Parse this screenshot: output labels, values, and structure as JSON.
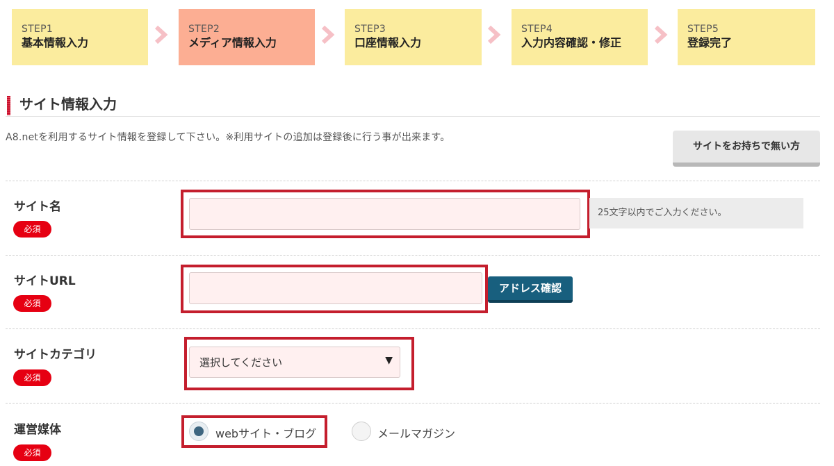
{
  "steps": [
    {
      "num": "STEP1",
      "title": "基本情報入力"
    },
    {
      "num": "STEP2",
      "title": "メディア情報入力"
    },
    {
      "num": "STEP3",
      "title": "口座情報入力"
    },
    {
      "num": "STEP4",
      "title": "入力内容確認・修正"
    },
    {
      "num": "STEP5",
      "title": "登録完了"
    }
  ],
  "section": {
    "title": "サイト情報入力",
    "description": "A8.netを利用するサイト情報を登録して下さい。※利用サイトの追加は登録後に行う事が出来ます。",
    "no_site_button": "サイトをお持ちで無い方"
  },
  "required_badge": "必須",
  "fields": {
    "site_name": {
      "label": "サイト名",
      "value": "",
      "hint": "25文字以内でご入力ください。"
    },
    "site_url": {
      "label": "サイトURL",
      "value": "",
      "check_button": "アドレス確認"
    },
    "site_category": {
      "label": "サイトカテゴリ",
      "selected": "選択してください",
      "arrow_icon": "triangle-down"
    },
    "media_type": {
      "label": "運営媒体",
      "options": [
        "webサイト・ブログ",
        "メールマガジン"
      ],
      "selected": "webサイト・ブログ"
    }
  },
  "colors": {
    "step_bg": "#fbec9e",
    "step_active_bg": "#fcae93",
    "chevron": "#f6c0c6",
    "highlight_border": "#c41e2d",
    "required_badge": "#e60012",
    "address_button": "#185f7e"
  }
}
